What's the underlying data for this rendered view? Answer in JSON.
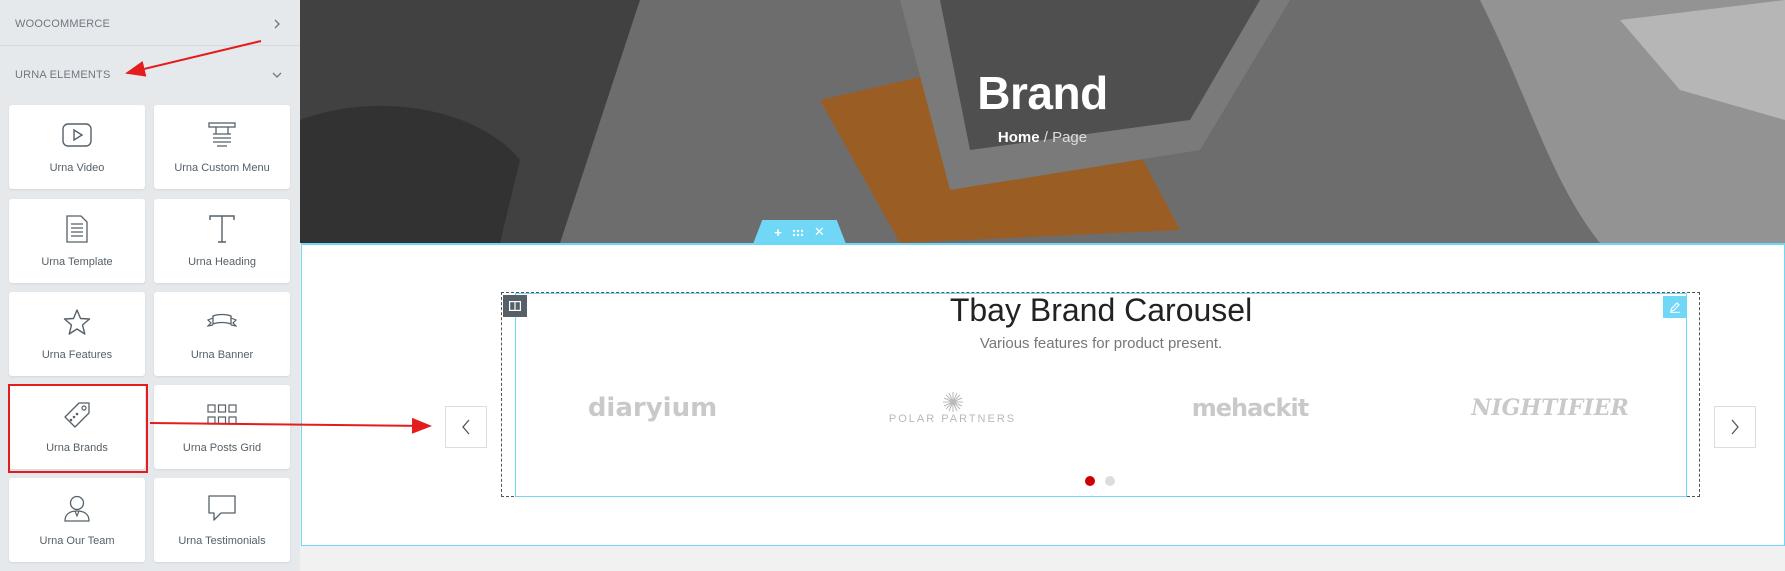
{
  "sidebar": {
    "sections": [
      {
        "label": "WOOCOMMERCE",
        "state": "collapsed"
      },
      {
        "label": "URNA ELEMENTS",
        "state": "expanded"
      }
    ],
    "widgets": [
      {
        "label": "Urna Video",
        "icon": "video-icon"
      },
      {
        "label": "Urna Custom Menu",
        "icon": "custom-menu-icon"
      },
      {
        "label": "Urna Template",
        "icon": "template-icon"
      },
      {
        "label": "Urna Heading",
        "icon": "heading-icon"
      },
      {
        "label": "Urna Features",
        "icon": "star-icon"
      },
      {
        "label": "Urna Banner",
        "icon": "banner-icon"
      },
      {
        "label": "Urna Brands",
        "icon": "tag-icon"
      },
      {
        "label": "Urna Posts Grid",
        "icon": "grid-icon"
      },
      {
        "label": "Urna Our Team",
        "icon": "person-icon"
      },
      {
        "label": "Urna Testimonials",
        "icon": "speech-bubble-icon"
      }
    ]
  },
  "hero": {
    "title": "Brand",
    "breadcrumb_home": "Home",
    "breadcrumb_sep": " / ",
    "breadcrumb_current": "Page"
  },
  "carousel": {
    "title": "Tbay Brand Carousel",
    "subtitle": "Various features for product present.",
    "brands": [
      "diaryium",
      "POLAR PARTNERS",
      "mehackit",
      "NIGHTIFIER"
    ],
    "active_dot": 1,
    "dot_count": 2
  },
  "colors": {
    "accent": "#71d7f7",
    "annotation_red": "#e31d1d",
    "active_dot": "#cc0000"
  }
}
